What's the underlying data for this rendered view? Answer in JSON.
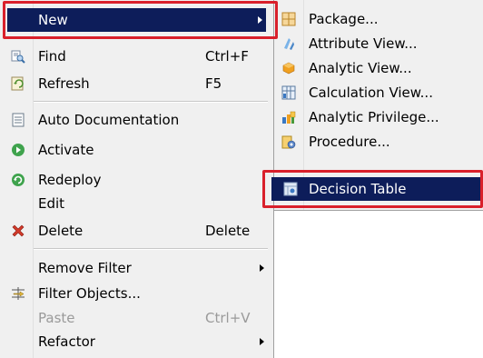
{
  "context_menu": {
    "items": [
      {
        "label": "New",
        "shortcut": "",
        "has_submenu": true,
        "icon": "none",
        "selected": true
      },
      {
        "label": "Find",
        "shortcut": "Ctrl+F",
        "icon": "find-icon"
      },
      {
        "label": "Refresh",
        "shortcut": "F5",
        "icon": "refresh-icon"
      },
      {
        "label": "Auto Documentation",
        "shortcut": "",
        "icon": "document-icon"
      },
      {
        "label": "Activate",
        "shortcut": "",
        "icon": "activate-icon"
      },
      {
        "label": "Redeploy",
        "shortcut": "",
        "icon": "redeploy-icon"
      },
      {
        "label": "Edit",
        "shortcut": "",
        "icon": "none"
      },
      {
        "label": "Delete",
        "shortcut": "Delete",
        "icon": "delete-icon"
      },
      {
        "label": "Remove Filter",
        "shortcut": "",
        "has_submenu": true,
        "icon": "none"
      },
      {
        "label": "Filter Objects...",
        "shortcut": "",
        "icon": "filter-icon"
      },
      {
        "label": "Paste",
        "shortcut": "Ctrl+V",
        "icon": "none",
        "disabled": true
      },
      {
        "label": "Refactor",
        "shortcut": "",
        "has_submenu": true,
        "icon": "none"
      }
    ]
  },
  "submenu_new": {
    "items": [
      {
        "label": "Package...",
        "icon": "package-icon"
      },
      {
        "label": "Attribute View...",
        "icon": "attribute-view-icon"
      },
      {
        "label": "Analytic View...",
        "icon": "analytic-view-icon"
      },
      {
        "label": "Calculation View...",
        "icon": "calculation-view-icon"
      },
      {
        "label": "Analytic Privilege...",
        "icon": "analytic-privilege-icon"
      },
      {
        "label": "Procedure...",
        "icon": "procedure-icon"
      },
      {
        "label": "Decision Table",
        "icon": "decision-table-icon",
        "selected": true
      }
    ]
  },
  "colors": {
    "highlight": "#0d1d5a",
    "annotation_red": "#d9202b",
    "menu_bg": "#f0f0f0",
    "disabled_text": "#9a9a9a"
  }
}
